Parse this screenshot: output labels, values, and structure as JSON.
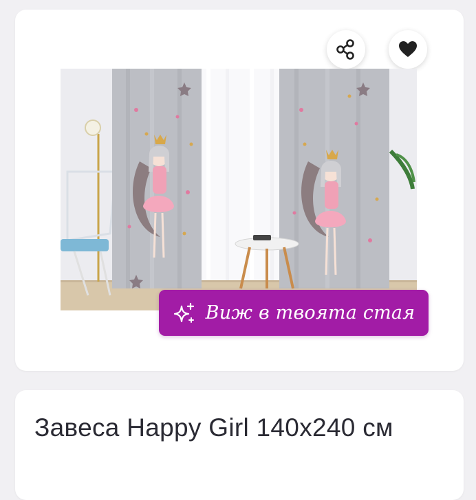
{
  "gallery": {
    "share_icon": "share-icon",
    "favorite_icon": "heart-icon",
    "image_subject": "curtains",
    "ar_button": {
      "icon": "sparkles-icon",
      "label": "Виж в твоята стая"
    }
  },
  "product": {
    "title": "Завеса Happy Girl 140x240 см"
  },
  "colors": {
    "page_background": "#f1f0f3",
    "card_background": "#ffffff",
    "ar_button": "#a21ca6",
    "title_text": "#2a2a33"
  }
}
